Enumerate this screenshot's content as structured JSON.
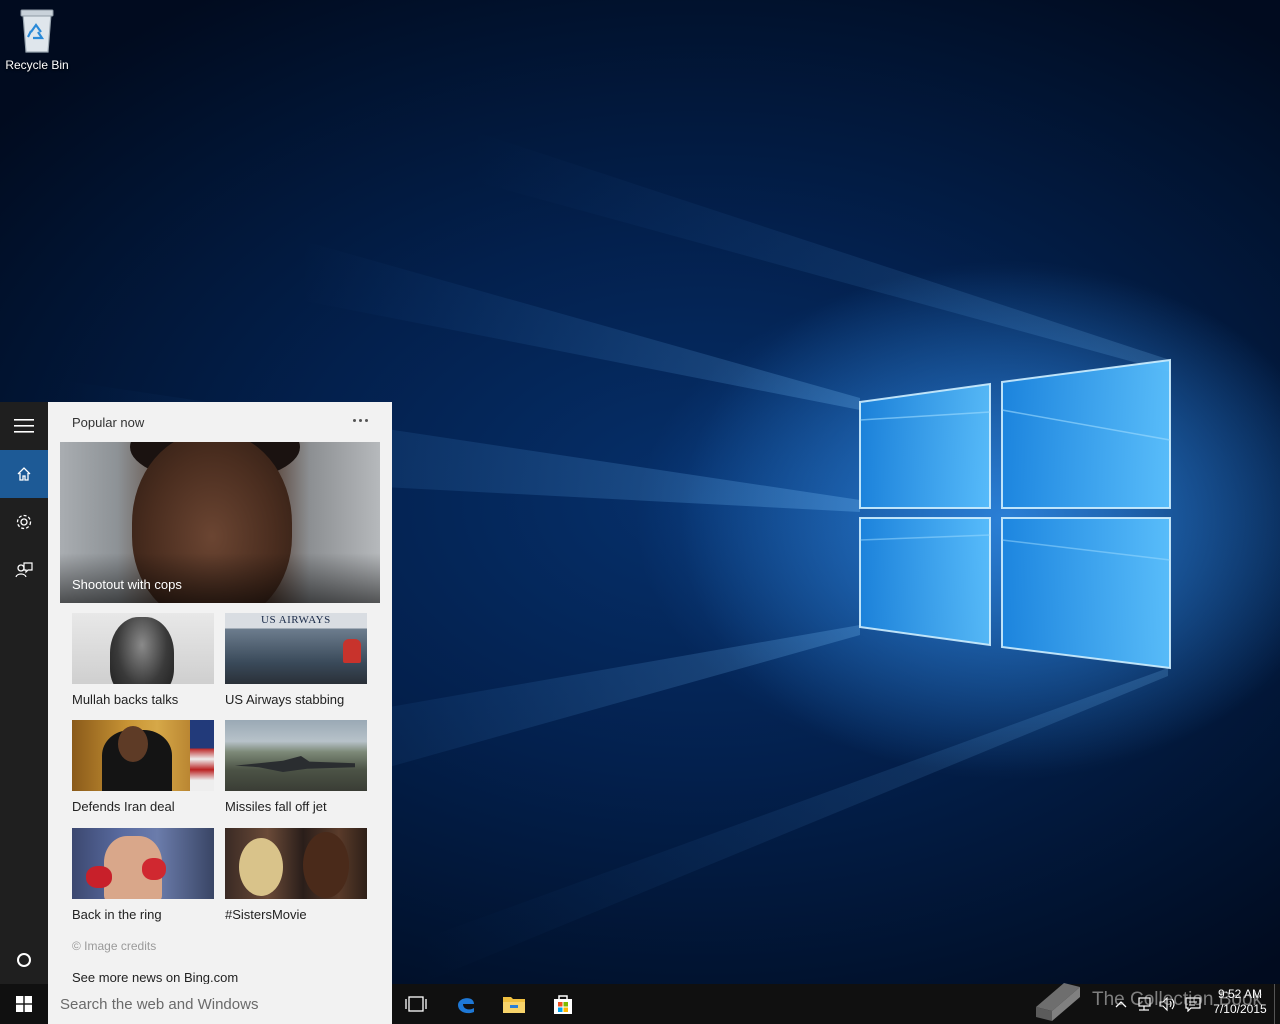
{
  "desktop": {
    "recycle_bin_label": "Recycle Bin",
    "icon": "recycle-bin-icon"
  },
  "cortana": {
    "rail": [
      {
        "icon": "hamburger-menu-icon"
      },
      {
        "icon": "home-icon",
        "active": true
      },
      {
        "icon": "settings-icon"
      },
      {
        "icon": "feedback-icon"
      },
      {
        "icon": "cortana-circle-icon"
      }
    ],
    "section_title": "Popular now",
    "more_icon": "more-options-icon",
    "hero": {
      "caption": "Shootout with cops"
    },
    "tiles": [
      {
        "caption": "Mullah backs talks"
      },
      {
        "caption": "US Airways stabbing",
        "thumb_text": "US AIRWAYS"
      },
      {
        "caption": "Defends Iran deal"
      },
      {
        "caption": "Missiles fall off jet"
      },
      {
        "caption": "Back in the ring"
      },
      {
        "caption": "#SistersMovie"
      }
    ],
    "credits": "© Image credits",
    "more_news": "See more news on Bing.com"
  },
  "taskbar": {
    "start_icon": "windows-start-icon",
    "search_placeholder": "Search the web and Windows",
    "apps": [
      {
        "name": "task-view",
        "icon": "task-view-icon"
      },
      {
        "name": "edge",
        "icon": "edge-icon"
      },
      {
        "name": "file-explorer",
        "icon": "folder-icon"
      },
      {
        "name": "store",
        "icon": "store-icon"
      }
    ],
    "tray_icons": [
      "chevron-up-icon",
      "network-icon",
      "volume-icon",
      "action-center-icon"
    ],
    "clock_time": "9:52 AM",
    "clock_date": "7/10/2015"
  },
  "watermark": {
    "text": "The Collection Book"
  },
  "colors": {
    "accent": "#1d5a96",
    "rail_bg": "#1f1f1f",
    "panel_bg": "#f2f2f2",
    "taskbar_bg": "#101010",
    "edge_blue": "#1e78d6",
    "folder_yellow": "#f0c040"
  }
}
